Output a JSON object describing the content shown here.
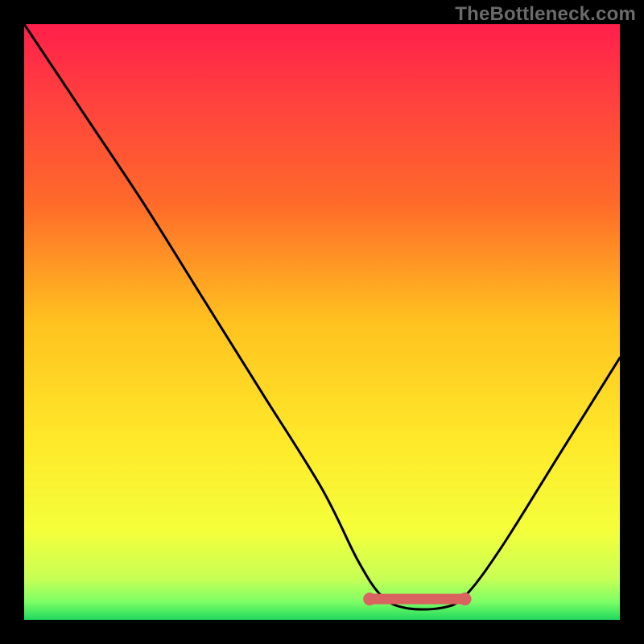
{
  "watermark": "TheBottleneck.com",
  "chart_data": {
    "type": "line",
    "title": "",
    "xlabel": "",
    "ylabel": "",
    "xlim": [
      0,
      100
    ],
    "ylim": [
      0,
      100
    ],
    "grid": false,
    "legend": false,
    "annotations": [],
    "curve": [
      {
        "x": 0,
        "y": 100
      },
      {
        "x": 10,
        "y": 85
      },
      {
        "x": 20,
        "y": 70
      },
      {
        "x": 30,
        "y": 54
      },
      {
        "x": 40,
        "y": 38
      },
      {
        "x": 50,
        "y": 22
      },
      {
        "x": 56,
        "y": 10
      },
      {
        "x": 60,
        "y": 4
      },
      {
        "x": 64,
        "y": 2
      },
      {
        "x": 70,
        "y": 2
      },
      {
        "x": 74,
        "y": 4
      },
      {
        "x": 80,
        "y": 12
      },
      {
        "x": 90,
        "y": 28
      },
      {
        "x": 100,
        "y": 44
      }
    ],
    "optimal_band": {
      "x_start": 58,
      "x_end": 74,
      "y": 3.5
    },
    "background_gradient": {
      "stops": [
        {
          "offset": 0.0,
          "color": "#ff1f4b"
        },
        {
          "offset": 0.12,
          "color": "#ff3f3f"
        },
        {
          "offset": 0.3,
          "color": "#ff6a2a"
        },
        {
          "offset": 0.5,
          "color": "#ffc21f"
        },
        {
          "offset": 0.7,
          "color": "#ffe92a"
        },
        {
          "offset": 0.85,
          "color": "#f4ff3a"
        },
        {
          "offset": 0.93,
          "color": "#c8ff55"
        },
        {
          "offset": 0.97,
          "color": "#7dff66"
        },
        {
          "offset": 1.0,
          "color": "#1fd85e"
        }
      ]
    },
    "band_color": "#d9635f",
    "curve_color": "#000000"
  }
}
